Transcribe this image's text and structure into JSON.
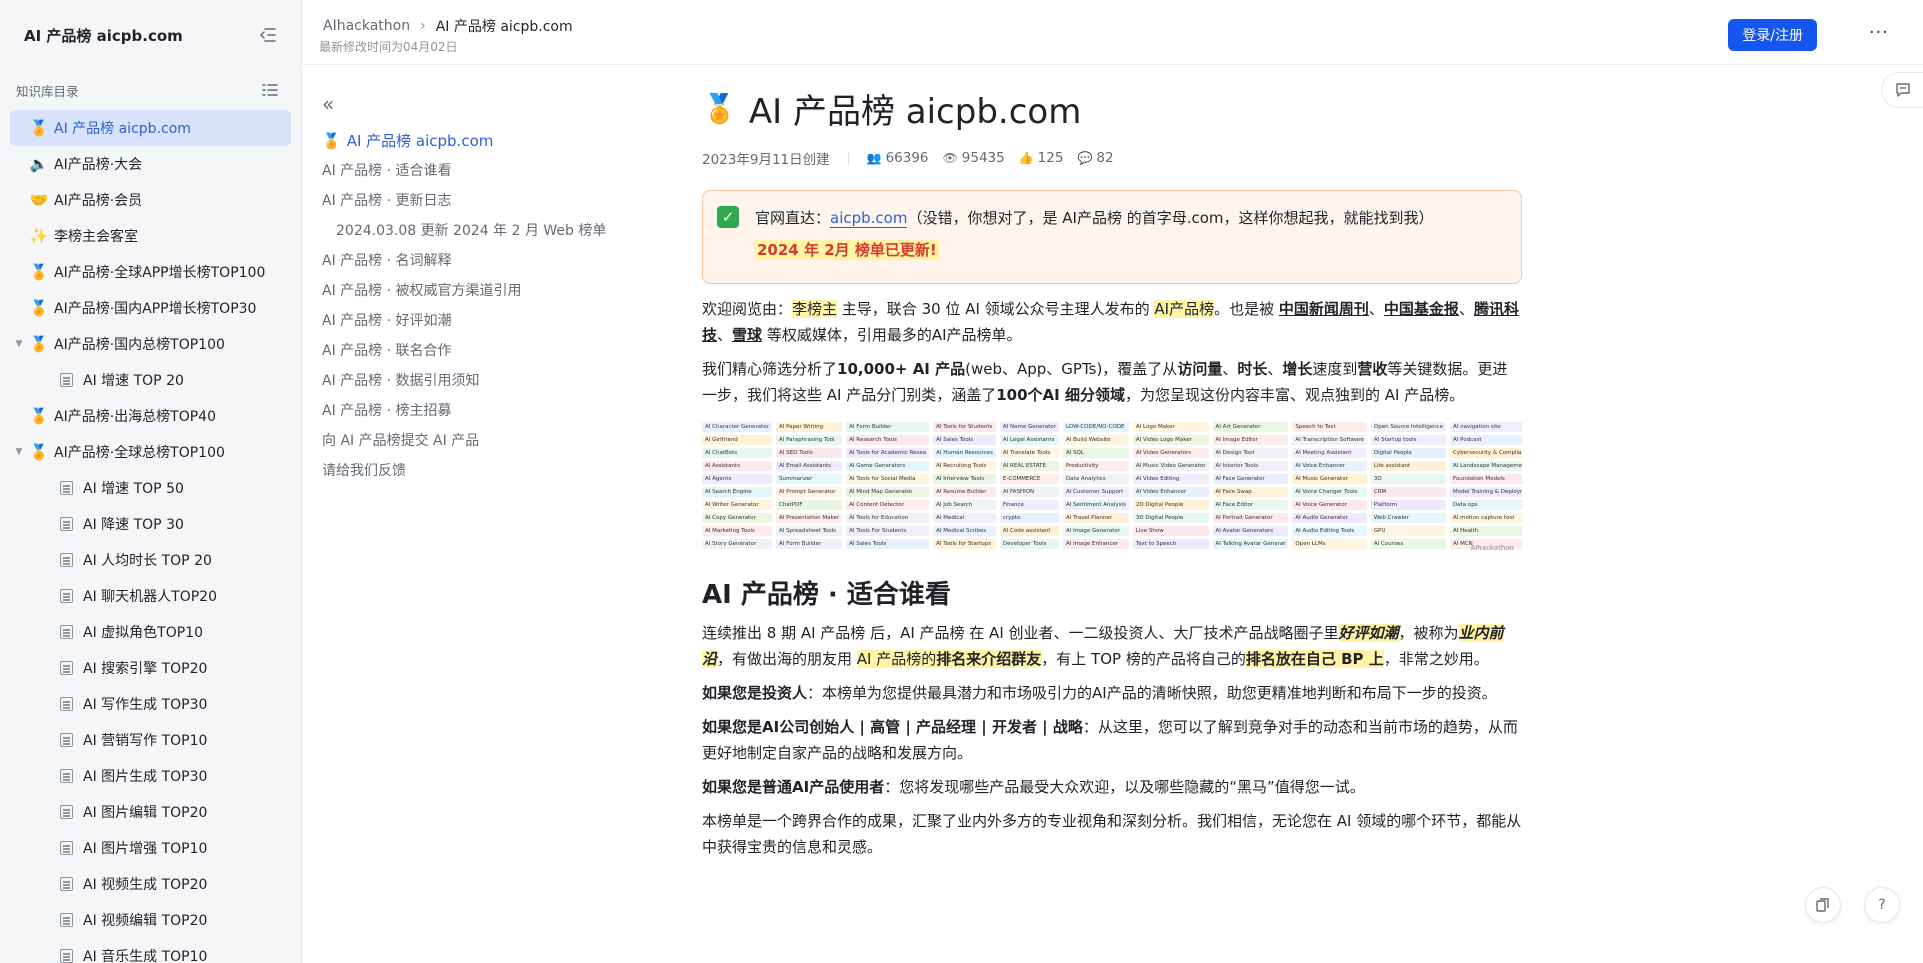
{
  "sidebar": {
    "title": "AI 产品榜 aicpb.com",
    "section_label": "知识库目录",
    "items": [
      {
        "emoji": "🏅",
        "label": "AI 产品榜 aicpb.com",
        "level": 0,
        "caret": false,
        "active": true
      },
      {
        "emoji": "🔈",
        "label": "AI产品榜·大会",
        "level": 0,
        "caret": false,
        "active": false
      },
      {
        "emoji": "🤝",
        "label": "AI产品榜·会员",
        "level": 0,
        "caret": false,
        "active": false
      },
      {
        "emoji": "✨",
        "label": "李榜主会客室",
        "level": 0,
        "caret": false,
        "active": false
      },
      {
        "emoji": "🏅",
        "label": "AI产品榜·全球APP增长榜TOP100",
        "level": 0,
        "caret": false,
        "active": false
      },
      {
        "emoji": "🏅",
        "label": "AI产品榜·国内APP增长榜TOP30",
        "level": 0,
        "caret": false,
        "active": false
      },
      {
        "emoji": "🏅",
        "label": "AI产品榜·国内总榜TOP100",
        "level": 0,
        "caret": true,
        "active": false
      },
      {
        "emoji": "",
        "label": "AI 增速 TOP 20",
        "level": 1,
        "caret": false,
        "active": false
      },
      {
        "emoji": "🏅",
        "label": "AI产品榜·出海总榜TOP40",
        "level": 0,
        "caret": false,
        "active": false
      },
      {
        "emoji": "🏅",
        "label": "AI产品榜·全球总榜TOP100",
        "level": 0,
        "caret": true,
        "active": false
      },
      {
        "emoji": "",
        "label": "AI 增速 TOP 50",
        "level": 1,
        "caret": false,
        "active": false
      },
      {
        "emoji": "",
        "label": "AI 降速 TOP 30",
        "level": 1,
        "caret": false,
        "active": false
      },
      {
        "emoji": "",
        "label": "AI 人均时长 TOP 20",
        "level": 1,
        "caret": false,
        "active": false
      },
      {
        "emoji": "",
        "label": "AI 聊天机器人TOP20",
        "level": 1,
        "caret": false,
        "active": false
      },
      {
        "emoji": "",
        "label": "AI 虚拟角色TOP10",
        "level": 1,
        "caret": false,
        "active": false
      },
      {
        "emoji": "",
        "label": "AI 搜索引擎 TOP20",
        "level": 1,
        "caret": false,
        "active": false
      },
      {
        "emoji": "",
        "label": "AI 写作生成 TOP30",
        "level": 1,
        "caret": false,
        "active": false
      },
      {
        "emoji": "",
        "label": "AI 营销写作 TOP10",
        "level": 1,
        "caret": false,
        "active": false
      },
      {
        "emoji": "",
        "label": "AI 图片生成 TOP30",
        "level": 1,
        "caret": false,
        "active": false
      },
      {
        "emoji": "",
        "label": "AI 图片编辑 TOP20",
        "level": 1,
        "caret": false,
        "active": false
      },
      {
        "emoji": "",
        "label": "AI 图片增强 TOP10",
        "level": 1,
        "caret": false,
        "active": false
      },
      {
        "emoji": "",
        "label": "AI 视频生成 TOP20",
        "level": 1,
        "caret": false,
        "active": false
      },
      {
        "emoji": "",
        "label": "AI 视频编辑 TOP20",
        "level": 1,
        "caret": false,
        "active": false
      },
      {
        "emoji": "",
        "label": "AI 音乐生成 TOP10",
        "level": 1,
        "caret": false,
        "active": false
      }
    ]
  },
  "topbar": {
    "crumb_root": "AIhackathon",
    "crumb_current": "AI 产品榜 aicpb.com",
    "modified": "最新修改时间为04月02日",
    "login_label": "登录/注册",
    "more_label": "···"
  },
  "outline": {
    "items": [
      {
        "label": "AI 产品榜 aicpb.com",
        "active": true,
        "sub": false,
        "emoji": "🏅"
      },
      {
        "label": "AI 产品榜 · 适合谁看",
        "active": false,
        "sub": false,
        "emoji": ""
      },
      {
        "label": "AI 产品榜 · 更新日志",
        "active": false,
        "sub": false,
        "emoji": ""
      },
      {
        "label": "2024.03.08 更新 2024 年 2 月 Web 榜单",
        "active": false,
        "sub": true,
        "emoji": ""
      },
      {
        "label": "AI 产品榜 · 名词解释",
        "active": false,
        "sub": false,
        "emoji": ""
      },
      {
        "label": "AI 产品榜 · 被权威官方渠道引用",
        "active": false,
        "sub": false,
        "emoji": ""
      },
      {
        "label": "AI 产品榜 · 好评如潮",
        "active": false,
        "sub": false,
        "emoji": ""
      },
      {
        "label": "AI 产品榜 · 联名合作",
        "active": false,
        "sub": false,
        "emoji": ""
      },
      {
        "label": "AI 产品榜 · 数据引用须知",
        "active": false,
        "sub": false,
        "emoji": ""
      },
      {
        "label": "AI 产品榜 · 榜主招募",
        "active": false,
        "sub": false,
        "emoji": ""
      },
      {
        "label": "向 AI 产品榜提交 AI 产品",
        "active": false,
        "sub": false,
        "emoji": ""
      },
      {
        "label": "请给我们反馈",
        "active": false,
        "sub": false,
        "emoji": ""
      }
    ]
  },
  "doc": {
    "title_emoji": "🏅",
    "title": "AI 产品榜  aicpb.com",
    "created": "2023年9月11日创建",
    "stats": {
      "collaborators": "66396",
      "views": "95435",
      "likes": "125",
      "comments": "82"
    },
    "callout": {
      "prefix": "官网直达：",
      "link": "aicpb.com",
      "suffix": "（没错，你想对了，是 AI产品榜 的首字母.com，这样你想起我，就能找到我）",
      "notice": "2024 年 2月 榜单已更新!"
    },
    "p1": {
      "t1": "欢迎阅览由：",
      "hl1": "李榜主",
      "t2": " 主导，联合 30 位 AI 领域公众号主理人发布的 ",
      "hl2": "AI产品榜",
      "t3": "。也是被 ",
      "u1": "中国新闻周刊",
      "s1": "、",
      "u2": "中国基金报",
      "s2": "、",
      "u3": "腾讯科技",
      "s3": "、",
      "u4": "雪球",
      "t4": " 等权威媒体，引用最多的AI产品榜单。"
    },
    "p2": {
      "t1": "我们精心筛选分析了",
      "b1": "10,000+ AI 产品",
      "t2": "(web、App、GPTs)，覆盖了从",
      "b2": "访问量",
      "s1": "、",
      "b3": "时长",
      "s2": "、",
      "b4": "增长",
      "t3": "速度到",
      "b5": "营收",
      "t4": "等关键数据。更进一步，我们将这些 AI 产品分门别类，涵盖了",
      "b6": "100个AI 细分领域",
      "t5": "，为您呈现这份内容丰富、观点独到的 AI 产品榜。"
    },
    "image_columns": [
      [
        "AI Character Generator",
        "AI Girlfriend",
        "AI ChatBots",
        "AI Assistants",
        "AI Agents",
        "AI Search Engine",
        "AI Writer Generator",
        "AI Copy Generator",
        "AI Marketing Tools",
        "AI Story Generator"
      ],
      [
        "AI Paper Writing",
        "AI Paraphrasing Tool",
        "AI SEO Tools",
        "AI Email Assistants",
        "Summarizer",
        "AI Prompt Generator",
        "ChatPDF",
        "AI Presentation Maker",
        "AI Spreadsheet Tools",
        "AI Form Builder"
      ],
      [
        "AI Form Builder",
        "AI Research Tools",
        "AI Tools for Academic Resea",
        "AI Game Generators",
        "AI Tools for Social Media",
        "AI Mind Map Generator",
        "AI Content Detector",
        "AI Tools for Education",
        "AI Tools For Students",
        "AI Sales Tools"
      ],
      [
        "AI Tools for Students",
        "AI Sales Tools",
        "AI Human Resources",
        "AI Recruiting Tools",
        "AI Interview Tools",
        "AI Resume Builder",
        "AI Job Search",
        "AI Medical",
        "AI Medical Scribes",
        "AI Tools for Startups"
      ],
      [
        "AI Name Generator",
        "AI Legal Assistants",
        "AI Translate Tools",
        "AI REAL ESTATE",
        "E-COMMERCE",
        "AI FASHION",
        "Finance",
        "crypto",
        "AI Code assistant",
        "Developer Tools"
      ],
      [
        "LOW-CODE/NO-CODE",
        "AI Build Website",
        "AI SQL",
        "Productivity",
        "Data Analytics",
        "AI Customer Support",
        "AI Sentiment Analysis",
        "AI Travel Planner",
        "AI Image Generator",
        "AI Image Enhancer"
      ],
      [
        "AI Logo Maker",
        "AI Video Logo Maker",
        "AI Video Generators",
        "AI Music Video Generator",
        "AI Video Editing",
        "AI Video Enhancer",
        "2D Digital People",
        "3D Digital People",
        "Live Show",
        "Text to Speech"
      ],
      [
        "AI Art Generator",
        "AI Image Editor",
        "AI Design Tool",
        "AI Interior Tools",
        "AI Face Generator",
        "AI Face Swap",
        "AI Face Editor",
        "AI Portrait Generator",
        "AI Avatar Generators",
        "AI Talking Avatar Generat"
      ],
      [
        "Speech to Text",
        "AI Transcription Software",
        "AI Meeting Assistant",
        "AI Voice Enhancer",
        "AI Music Generator",
        "AI Voice Changer Tools",
        "AI Voice Generator",
        "AI Audio Generator",
        "AI Audio Editing Tools",
        "Open LLMs"
      ],
      [
        "Open Source Intelligence",
        "AI Startup tools",
        "Digital People",
        "Life assistant",
        "3D",
        "CRM",
        "Platform",
        "Web Crawler",
        "GPU",
        "AI Courses"
      ],
      [
        "AI navigation site",
        "AI Podcast",
        "Cybersecurity & Complia",
        "AI Landscape Management",
        "Foundation Models",
        "Model Training & Deploym",
        "Data ops",
        "AI motion capture tool",
        "AI Health",
        "AI MCN"
      ]
    ],
    "image_watermark": "AIhackathon",
    "h2": "AI 产品榜 · 适合谁看",
    "p3": {
      "t1": "连续推出 8 期 AI 产品榜 后，AI 产品榜 在 AI 创业者、一二级投资人、大厂技术产品战略圈子里",
      "bi1": "好评如潮",
      "t2": "，被称为",
      "bi2": "业内前沿",
      "t3": "，有做出海的朋友用 ",
      "hl1": "AI 产品榜的",
      "hlb1": "排名来介绍群友",
      "t4": "，有上 TOP 榜的产品将自己的",
      "hlb2": "排名放在自己 BP 上",
      "t5": "，非常之妙用。"
    },
    "p4": {
      "b": "如果您是投资人",
      "t": "：本榜单为您提供最具潜力和市场吸引力的AI产品的清晰快照，助您更精准地判断和布局下一步的投资。"
    },
    "p5": {
      "b": "如果您是AI公司创始人 | 高管 | 产品经理 | 开发者 | 战略",
      "t": "：从这里，您可以了解到竞争对手的动态和当前市场的趋势，从而更好地制定自家产品的战略和发展方向。"
    },
    "p6": {
      "b": "如果您是普通AI产品使用者",
      "t": "：您将发现哪些产品最受大众欢迎，以及哪些隐藏的“黑马”值得您一试。"
    },
    "p7": "本榜单是一个跨界合作的成果，汇聚了业内外多方的专业视角和深刻分析。我们相信，无论您在 AI 领域的哪个环节，都能从中获得宝贵的信息和灵感。"
  },
  "colors": {
    "accent": "#1456f0",
    "active_bg": "#d9e2fb",
    "highlight": "#fff3a6",
    "notice_red": "#d83931"
  }
}
